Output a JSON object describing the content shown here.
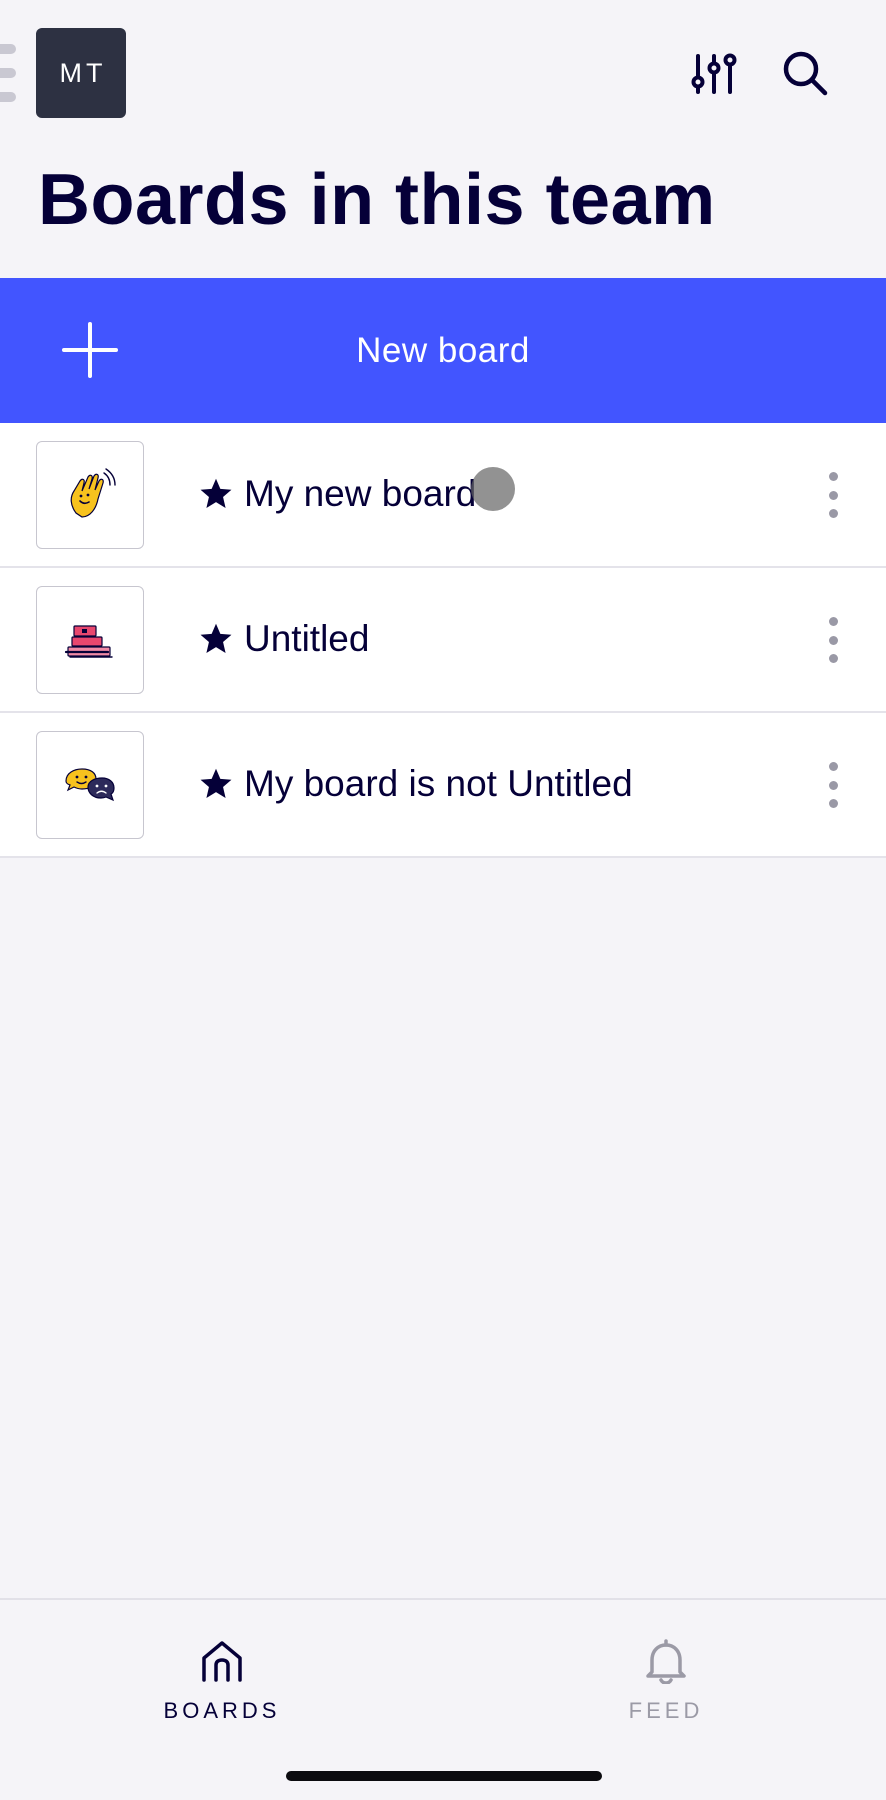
{
  "header": {
    "avatar_initials": "MT",
    "title": "Boards in this team",
    "icons": [
      "filter-sliders-icon",
      "search-icon"
    ]
  },
  "new_board": {
    "label": "New board",
    "icon": "plus-icon"
  },
  "boards": [
    {
      "title": "My new board",
      "starred": true,
      "thumbnail": "waving-hand-icon"
    },
    {
      "title": "Untitled",
      "starred": true,
      "thumbnail": "books-stack-icon"
    },
    {
      "title": "My board is not Untitled",
      "starred": true,
      "thumbnail": "chat-bubbles-icon"
    }
  ],
  "bottom_nav": {
    "items": [
      {
        "label": "BOARDS",
        "icon": "home-icon",
        "active": true
      },
      {
        "label": "FEED",
        "icon": "bell-icon",
        "active": false
      }
    ]
  },
  "colors": {
    "accent": "#4255ff",
    "text": "#050038",
    "background": "#f5f4f8",
    "avatar": "#2d3142",
    "muted": "#9b9aa6"
  }
}
